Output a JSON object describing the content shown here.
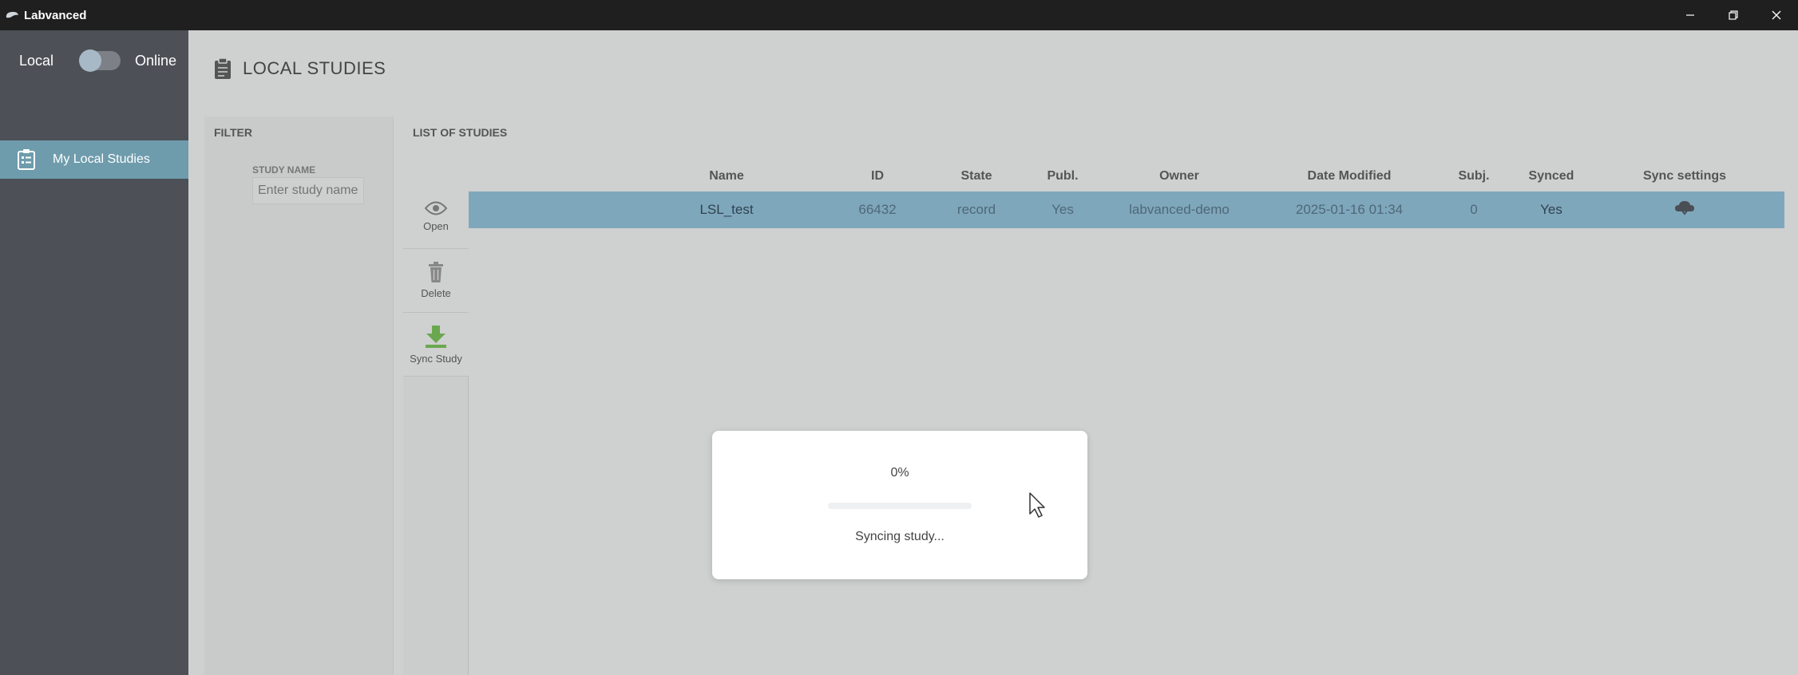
{
  "window": {
    "title": "Labvanced"
  },
  "sidebar": {
    "mode_left": "Local",
    "mode_right": "Online",
    "mode_value": "Local",
    "items": [
      {
        "label": "My Local Studies",
        "icon": "clipboard-list-icon",
        "active": true
      }
    ]
  },
  "header": {
    "title": "LOCAL STUDIES",
    "icon": "clipboard-icon"
  },
  "filter": {
    "heading": "FILTER",
    "study_name_label": "STUDY NAME",
    "study_name_placeholder": "Enter study name",
    "study_name_value": ""
  },
  "studies": {
    "heading": "LIST OF STUDIES",
    "actions": [
      {
        "label": "Open",
        "icon": "eye-icon"
      },
      {
        "label": "Delete",
        "icon": "trash-icon"
      },
      {
        "label": "Sync Study",
        "icon": "download-arrow-icon"
      }
    ],
    "columns": [
      "Name",
      "ID",
      "State",
      "Publ.",
      "Owner",
      "Date Modified",
      "Subj.",
      "Synced",
      "Sync settings"
    ],
    "rows": [
      {
        "name": "LSL_test",
        "id": "66432",
        "state": "record",
        "publ": "Yes",
        "owner": "labvanced-demo",
        "date_modified": "2025-01-16 01:34",
        "subj": "0",
        "synced": "Yes",
        "sync_settings_icon": "cloud-sync-icon",
        "selected": true
      }
    ]
  },
  "dialog": {
    "percent": "0%",
    "progress_fraction": 0,
    "status": "Syncing study..."
  },
  "colors": {
    "accent": "#6e9cac",
    "sidebar_bg": "#4d5056",
    "titlebar_bg": "#1f1f1f",
    "row_selected": "#7fa7bb",
    "sync_icon": "#6aa84f"
  }
}
